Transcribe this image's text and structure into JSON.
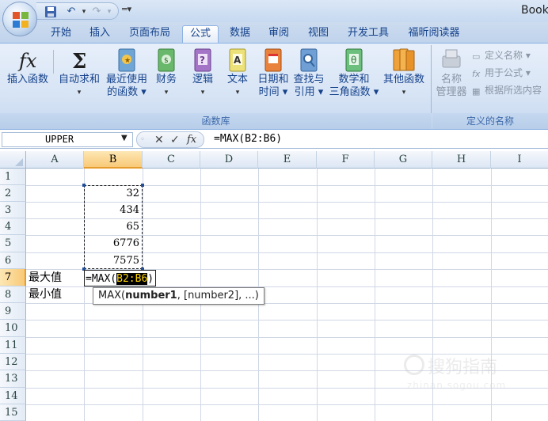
{
  "window": {
    "title": "Book"
  },
  "tabs": [
    {
      "label": "开始",
      "active": false
    },
    {
      "label": "插入",
      "active": false
    },
    {
      "label": "页面布局",
      "active": false
    },
    {
      "label": "公式",
      "active": true
    },
    {
      "label": "数据",
      "active": false
    },
    {
      "label": "审阅",
      "active": false
    },
    {
      "label": "视图",
      "active": false
    },
    {
      "label": "开发工具",
      "active": false
    },
    {
      "label": "福昕阅读器",
      "active": false
    }
  ],
  "ribbon": {
    "buttons": [
      {
        "line1": "插入函数",
        "line2": "",
        "icon": "insert-function-icon"
      },
      {
        "line1": "自动求和",
        "line2": "▾",
        "icon": "sum-icon"
      },
      {
        "line1": "最近使用",
        "line2": "的函数 ▾",
        "icon": "recent-functions-book-icon"
      },
      {
        "line1": "财务",
        "line2": "▾",
        "icon": "financial-book-icon"
      },
      {
        "line1": "逻辑",
        "line2": "▾",
        "icon": "logical-book-icon"
      },
      {
        "line1": "文本",
        "line2": "▾",
        "icon": "text-book-icon"
      },
      {
        "line1": "日期和",
        "line2": "时间 ▾",
        "icon": "date-time-book-icon"
      },
      {
        "line1": "查找与",
        "line2": "引用 ▾",
        "icon": "lookup-book-icon"
      },
      {
        "line1": "数学和",
        "line2": "三角函数 ▾",
        "icon": "math-book-icon"
      },
      {
        "line1": "其他函数",
        "line2": "▾",
        "icon": "more-functions-book-icon"
      }
    ],
    "name_manager": {
      "line1": "名称",
      "line2": "管理器"
    },
    "small_items": [
      {
        "label": "定义名称 ▾"
      },
      {
        "label": "用于公式 ▾"
      },
      {
        "label": "根据所选内容"
      }
    ],
    "group_labels": {
      "function_library": "函数库",
      "defined_names": "定义的名称"
    }
  },
  "formula_bar": {
    "name_box": "UPPER",
    "cancel_symbol": "✕",
    "enter_symbol": "✓",
    "fx_symbol": "fx",
    "formula": "=MAX(B2:B6)"
  },
  "sheet": {
    "columns": [
      "A",
      "B",
      "C",
      "D",
      "E",
      "F",
      "G",
      "H",
      "I"
    ],
    "rows": [
      "1",
      "2",
      "3",
      "4",
      "5",
      "6",
      "7",
      "8",
      "9",
      "10",
      "11",
      "12",
      "13",
      "14",
      "15"
    ],
    "b_values": [
      "32",
      "434",
      "65",
      "6776",
      "7575"
    ],
    "a7": "最大值",
    "a8": "最小值",
    "edit_prefix": "=MAX(",
    "edit_ref": "B2:B6",
    "edit_suffix": ")",
    "tooltip_fn": "MAX(",
    "tooltip_arg1": "number1",
    "tooltip_rest": ", [number2], ...)"
  },
  "watermark": {
    "text": "搜狗指南",
    "url": "zhinan.sogou.com"
  },
  "colors": {
    "ref_highlight_bg": "#000000",
    "ref_highlight_fg": "#ffd400",
    "selected_header": "#f8c978"
  }
}
